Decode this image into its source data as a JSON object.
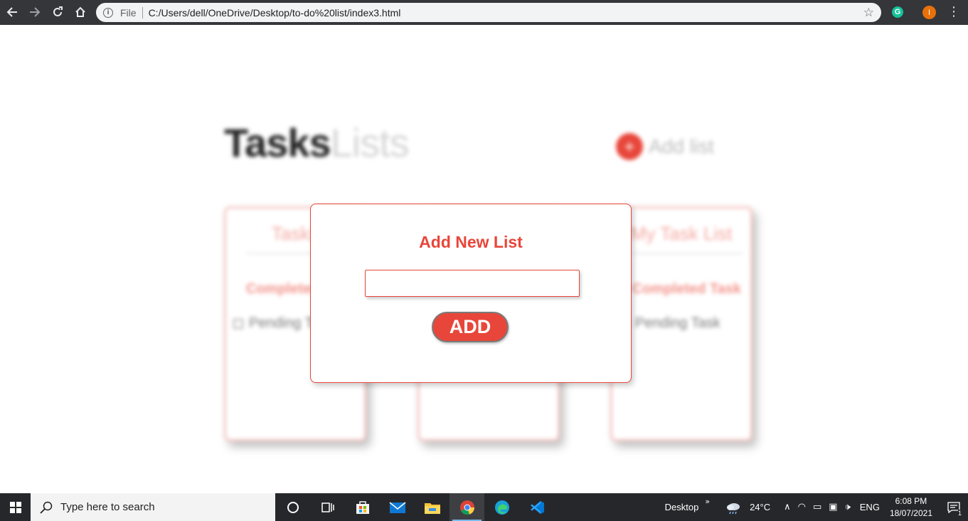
{
  "browser": {
    "omnibox_prefix": "File",
    "url": "C:/Users/dell/OneDrive/Desktop/to-do%20list/index3.html",
    "grammarly_letter": "G",
    "profile_initial": "I"
  },
  "background_page": {
    "title_bold": "Tasks",
    "title_light": "Lists",
    "add_list_label": "Add list",
    "cards": [
      {
        "title": "Tasks",
        "completed": "Completed",
        "pending": "Pending Task"
      },
      {
        "title": "",
        "completed": "",
        "pending": ""
      },
      {
        "title": "My Task List",
        "completed": "Completed Task",
        "pending": "Pending Task"
      }
    ]
  },
  "modal": {
    "title": "Add New List",
    "input_value": "",
    "add_label": "ADD"
  },
  "taskbar": {
    "search_placeholder": "Type here to search",
    "desktop_label": "Desktop",
    "weather": "24°C",
    "language": "ENG",
    "time": "6:08 PM",
    "date": "18/07/2021",
    "notification_count": "1"
  },
  "colors": {
    "accent": "#e8463a",
    "browser_bar": "#35363a",
    "taskbar": "#26272b"
  }
}
